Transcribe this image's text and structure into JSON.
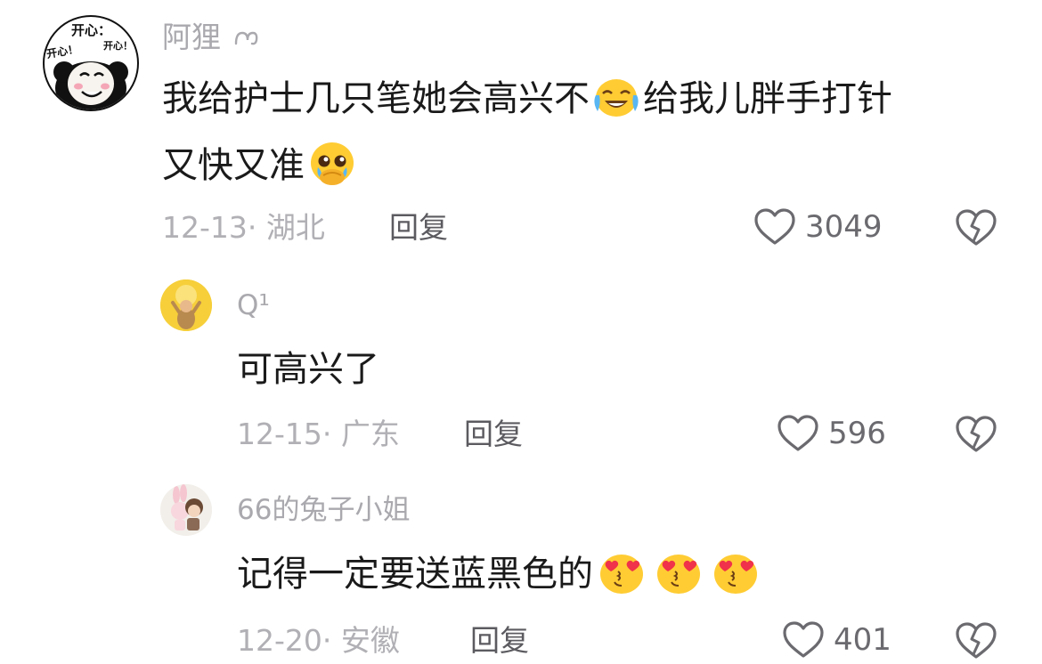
{
  "comments": [
    {
      "username": "阿狸",
      "username_icon": "swirl-icon",
      "avatar_text": {
        "top": "开心：",
        "left": "开心！",
        "right": "开心！"
      },
      "text_line1_a": "我给护士几只笔她会高兴不",
      "text_line1_b": "给我儿胖手打针",
      "text_line2": "又快又准",
      "emoji1": "face-with-tears-of-joy-icon",
      "emoji2": "pleading-face-icon",
      "date_location": "12-13· 湖北",
      "reply_label": "回复",
      "likes": "3049"
    },
    {
      "username": "Q¹",
      "text": "可高兴了",
      "date_location": "12-15· 广东",
      "reply_label": "回复",
      "likes": "596"
    },
    {
      "username": "66的兔子小姐",
      "text": "记得一定要送蓝黑色的",
      "emoji": "smiling-face-with-heart-eyes-icon",
      "emoji_count": 3,
      "date_location": "12-20· 安徽",
      "reply_label": "回复",
      "likes": "401"
    }
  ],
  "colors": {
    "username": "#a9a9ae",
    "text": "#1a1a1a",
    "meta": "#b0b0b5",
    "reply": "#5b5b60",
    "likes": "#6a6a6f",
    "emoji_yellow": "#ffcc33",
    "heart_red": "#f0324a"
  }
}
